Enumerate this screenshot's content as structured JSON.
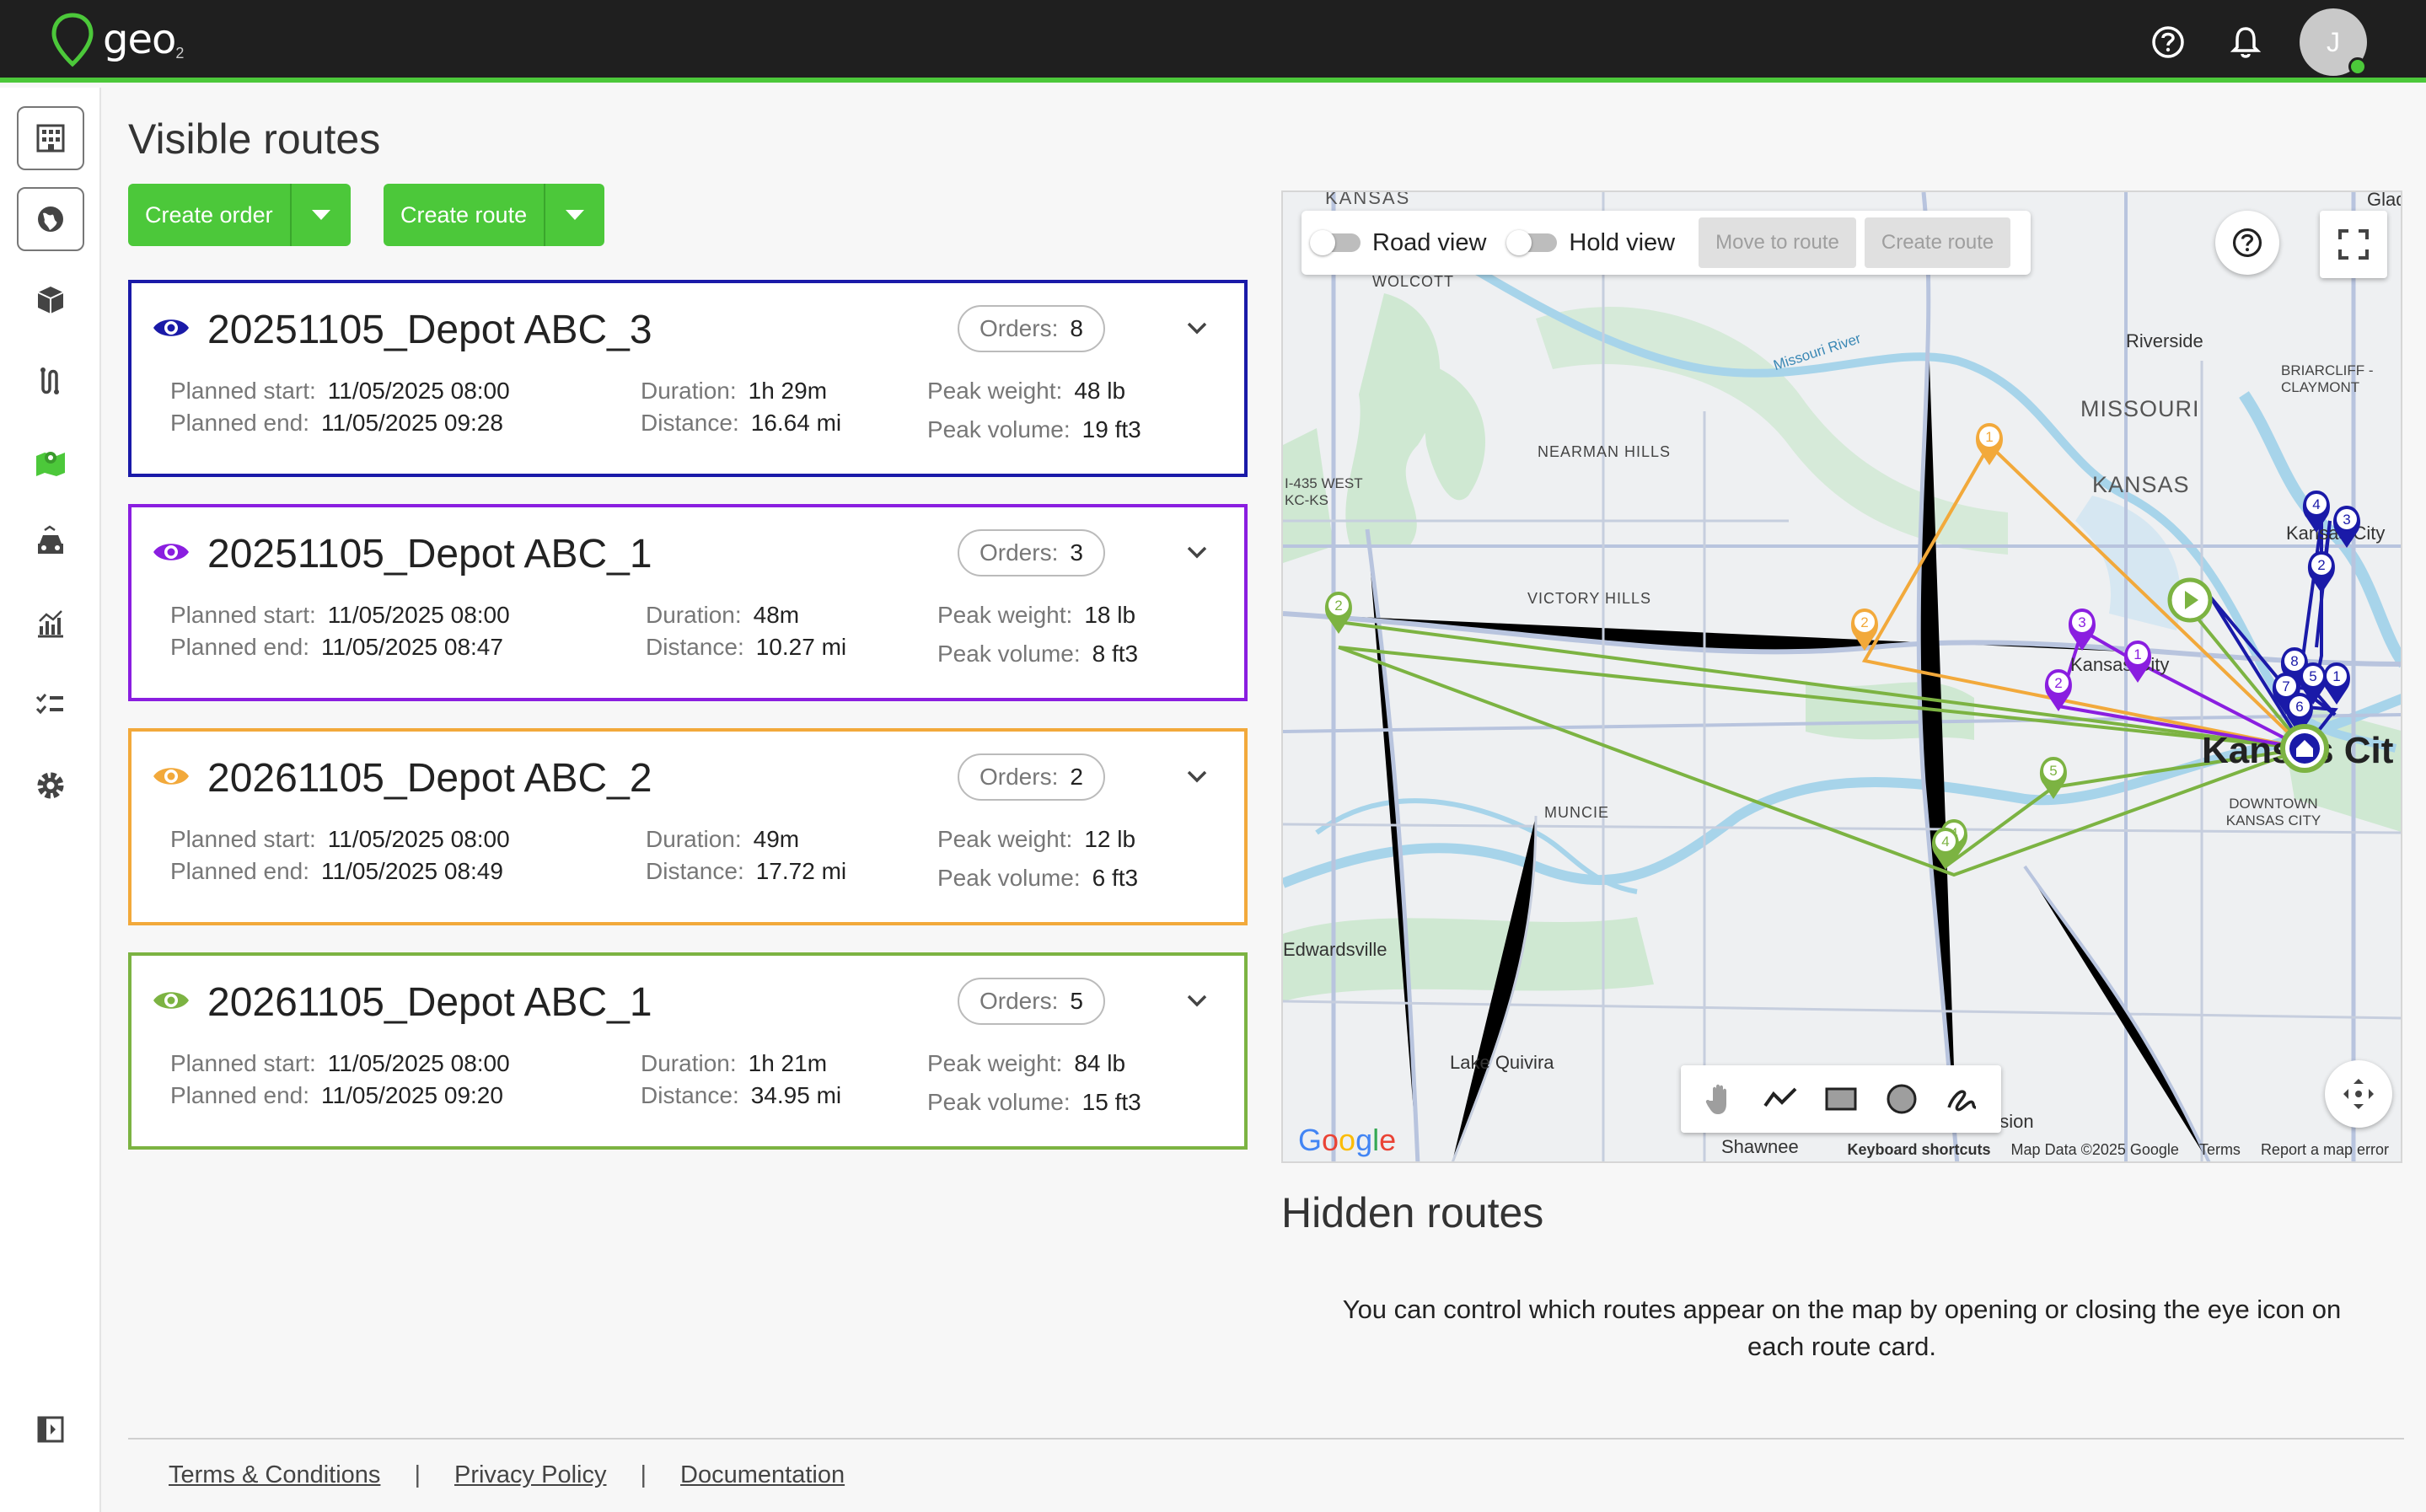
{
  "app": {
    "logo_text": "geo",
    "logo_sub": "2",
    "user_initial": "J"
  },
  "page": {
    "title": "Visible routes"
  },
  "toolbar": {
    "create_order": "Create order",
    "create_route": "Create route"
  },
  "routes": [
    {
      "name": "20251105_Depot ABC_3",
      "color": "#1a1aa8",
      "orders_label": "Orders:",
      "orders": "8",
      "planned_start_label": "Planned start:",
      "planned_start": "11/05/2025 08:00",
      "planned_end_label": "Planned end:",
      "planned_end": "11/05/2025 09:28",
      "duration_label": "Duration:",
      "duration": "1h 29m",
      "distance_label": "Distance:",
      "distance": "16.64 mi",
      "peak_weight_label": "Peak weight:",
      "peak_weight": "48 lb",
      "peak_volume_label": "Peak volume:",
      "peak_volume": "19 ft3"
    },
    {
      "name": "20251105_Depot ABC_1",
      "color": "#8a1ee0",
      "orders_label": "Orders:",
      "orders": "3",
      "planned_start_label": "Planned start:",
      "planned_start": "11/05/2025 08:00",
      "planned_end_label": "Planned end:",
      "planned_end": "11/05/2025 08:47",
      "duration_label": "Duration:",
      "duration": "48m",
      "distance_label": "Distance:",
      "distance": "10.27 mi",
      "peak_weight_label": "Peak weight:",
      "peak_weight": "18 lb",
      "peak_volume_label": "Peak volume:",
      "peak_volume": "8 ft3"
    },
    {
      "name": "20261105_Depot ABC_2",
      "color": "#f2a93b",
      "orders_label": "Orders:",
      "orders": "2",
      "planned_start_label": "Planned start:",
      "planned_start": "11/05/2025 08:00",
      "planned_end_label": "Planned end:",
      "planned_end": "11/05/2025 08:49",
      "duration_label": "Duration:",
      "duration": "49m",
      "distance_label": "Distance:",
      "distance": "17.72 mi",
      "peak_weight_label": "Peak weight:",
      "peak_weight": "12 lb",
      "peak_volume_label": "Peak volume:",
      "peak_volume": "6 ft3"
    },
    {
      "name": "20261105_Depot ABC_1",
      "color": "#7cb342",
      "orders_label": "Orders:",
      "orders": "5",
      "planned_start_label": "Planned start:",
      "planned_start": "11/05/2025 08:00",
      "planned_end_label": "Planned end:",
      "planned_end": "11/05/2025 09:20",
      "duration_label": "Duration:",
      "duration": "1h 21m",
      "distance_label": "Distance:",
      "distance": "34.95 mi",
      "peak_weight_label": "Peak weight:",
      "peak_weight": "84 lb",
      "peak_volume_label": "Peak volume:",
      "peak_volume": "15 ft3"
    }
  ],
  "map": {
    "road_view": "Road view",
    "hold_view": "Hold view",
    "move_to_route": "Move to route",
    "create_route": "Create route",
    "labels": [
      "KANSAS",
      "WOLCOTT",
      "Riverside",
      "BRIARCLIFF - CLAYMONT",
      "MISSOURI",
      "NEARMAN HILLS",
      "KANSAS",
      "I-435 WEST KC-KS",
      "Kansas City",
      "VICTORY HILLS",
      "Kansas City",
      "MUNCIE",
      "Kansas Cit",
      "DOWNTOWN KANSAS CITY",
      "Edwardsville",
      "Lake Quivira",
      "Mission",
      "Missouri River",
      "Glad"
    ],
    "google": "Google",
    "shawnee": "Shawnee",
    "footer": [
      "Keyboard shortcuts",
      "Map Data ©2025 Google",
      "Terms",
      "Report a map error"
    ]
  },
  "hidden": {
    "title": "Hidden routes",
    "description": "You can control which routes appear on the map by opening or closing the eye icon on each route card."
  },
  "footer": {
    "terms": "Terms & Conditions",
    "privacy": "Privacy Policy",
    "docs": "Documentation",
    "separator": "|"
  }
}
